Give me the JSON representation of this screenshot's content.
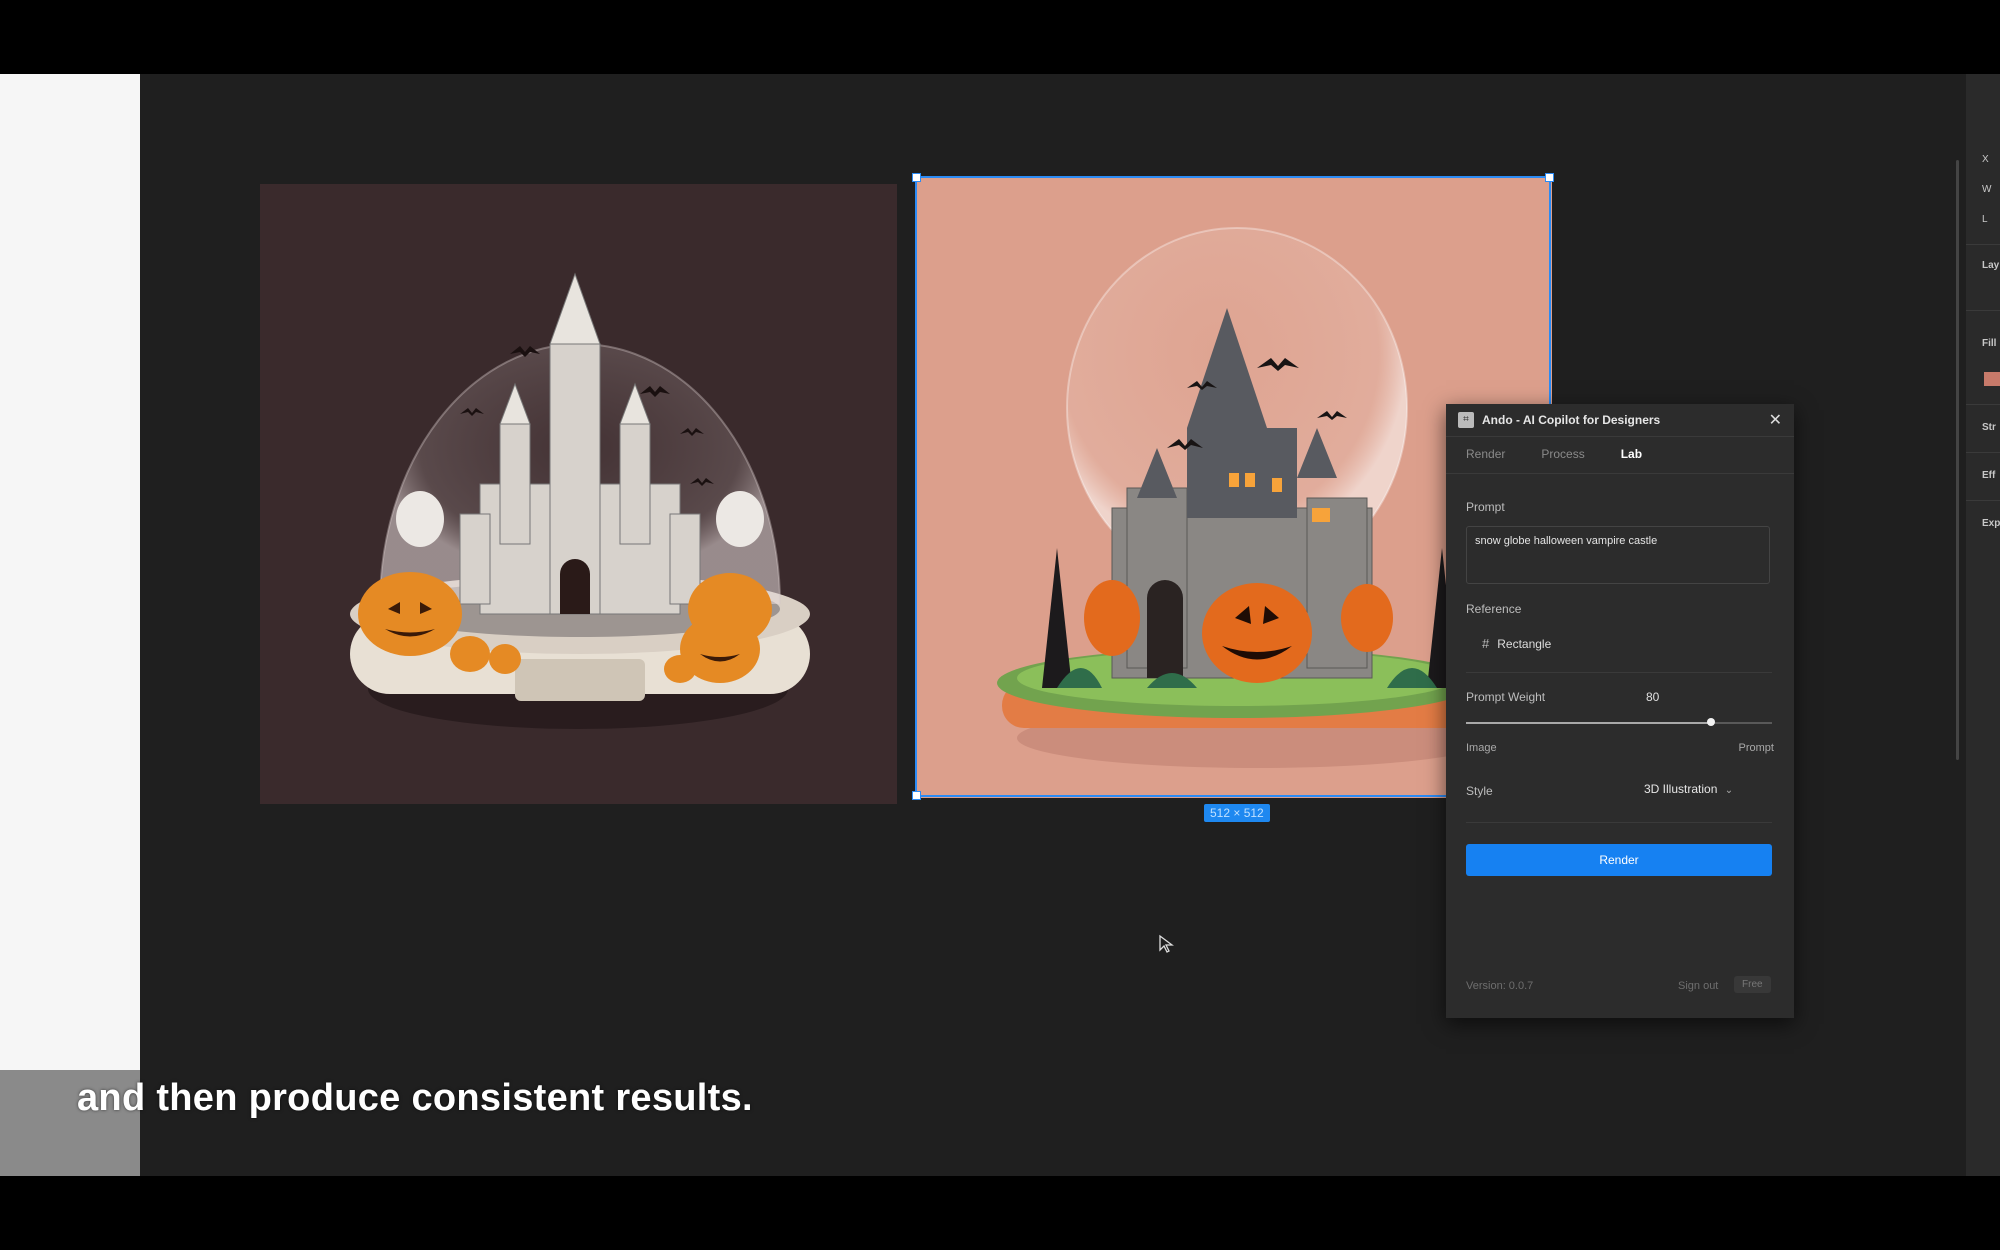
{
  "subtitle": "and then produce consistent results.",
  "canvas": {
    "selection_dimensions": "512 × 512"
  },
  "plugin": {
    "title": "Ando - AI Copilot for Designers",
    "tabs": [
      "Render",
      "Process",
      "Lab"
    ],
    "active_tab": "Lab",
    "prompt_label": "Prompt",
    "prompt_value": "snow globe halloween vampire castle",
    "reference_label": "Reference",
    "reference_value": "Rectangle",
    "prompt_weight_label": "Prompt Weight",
    "prompt_weight_value": "80",
    "slider_fraction": 0.8,
    "slider_left_label": "Image",
    "slider_right_label": "Prompt",
    "style_label": "Style",
    "style_value": "3D Illustration",
    "render_button": "Render",
    "version": "Version: 0.0.7",
    "sign_out": "Sign out",
    "plan_badge": "Free"
  },
  "right_panel": {
    "labels": [
      "X",
      "W",
      "L",
      "Lay",
      "Fill",
      "Str",
      "Eff",
      "Exp"
    ]
  },
  "colors": {
    "accent": "#1681f2",
    "selection": "#2c8bf4",
    "canvas_bg": "#1f1f1f",
    "image1_bg": "#3a2a2c",
    "image2_bg": "#dc9f8c"
  },
  "icons": [
    "plugin-logo-icon",
    "close-icon",
    "frame-icon",
    "chevron-down-icon",
    "cursor-icon"
  ]
}
